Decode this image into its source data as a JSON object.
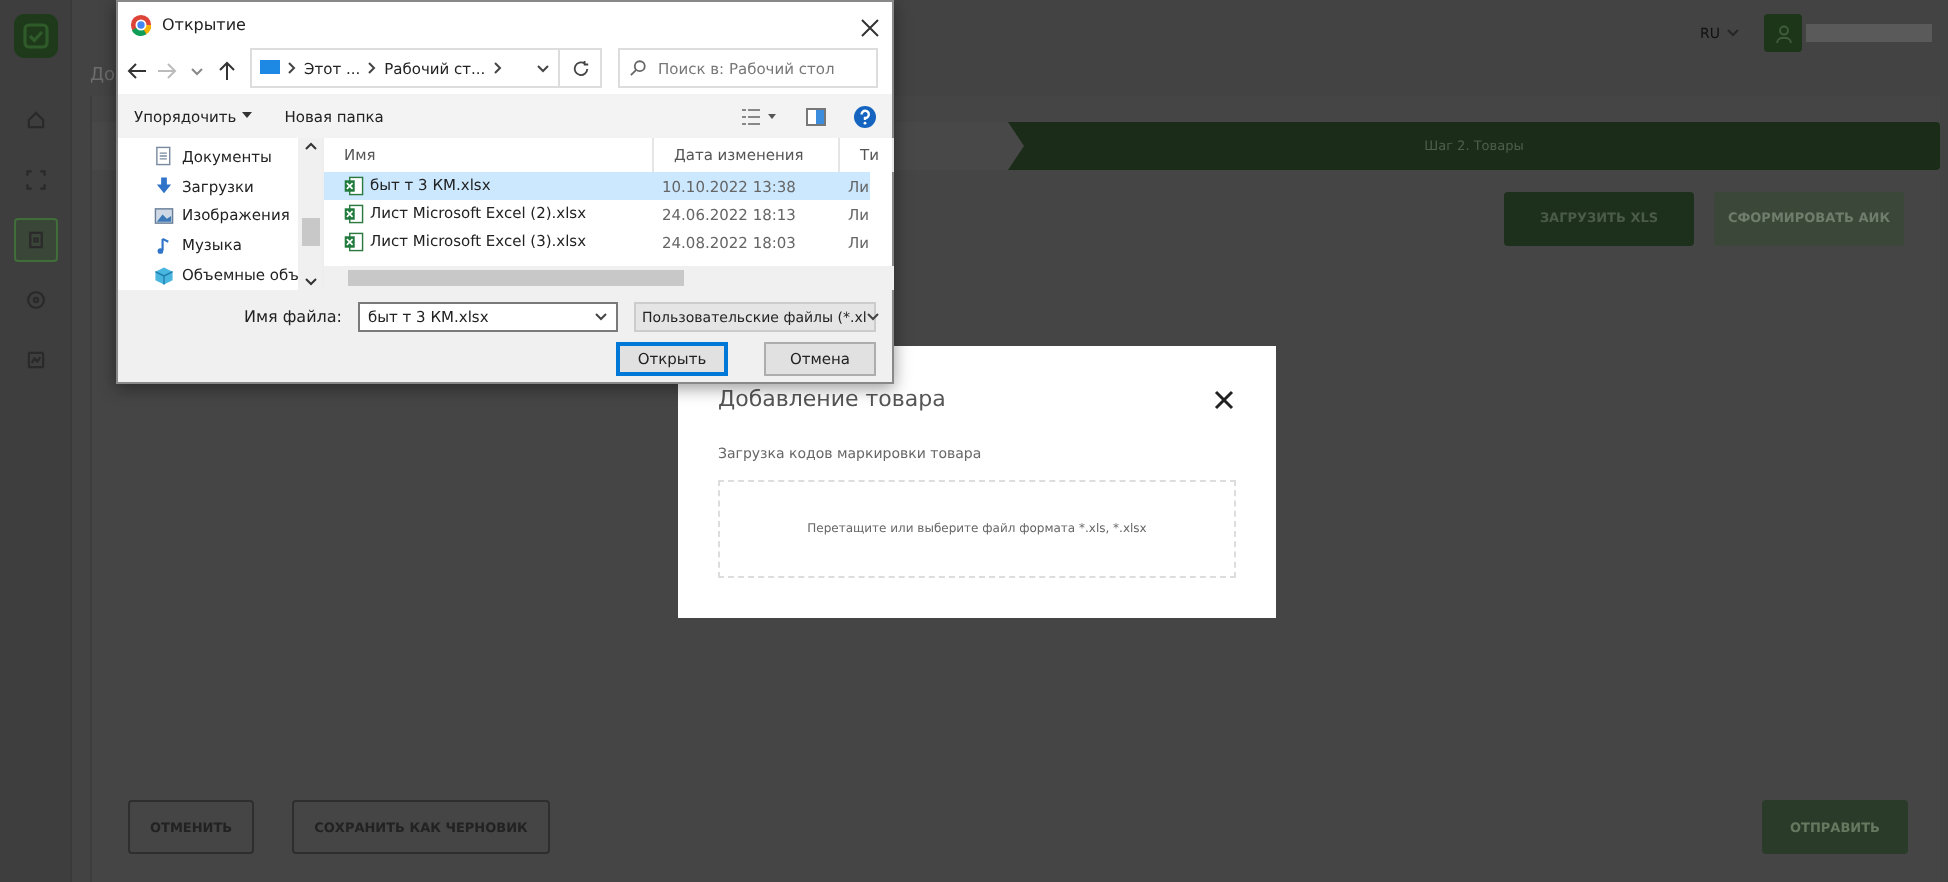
{
  "sidebar": {
    "items": [
      {
        "kind": "home",
        "selected": false
      },
      {
        "kind": "scan",
        "selected": false
      },
      {
        "kind": "document",
        "selected": true
      },
      {
        "kind": "wheel",
        "selected": false
      },
      {
        "kind": "report",
        "selected": false
      }
    ]
  },
  "header": {
    "language": "RU"
  },
  "breadcrumb": "До",
  "steps": [
    {
      "selected": false
    },
    {
      "label": "Шаг 2. Товары",
      "selected": true
    }
  ],
  "actions": [
    {
      "label": "ЗАГРУЗИТЬ XLS",
      "disabled": false
    },
    {
      "label": "СФОРМИРОВАТЬ АИК",
      "disabled": true
    }
  ],
  "footer": {
    "buttons": [
      {
        "label": "ОТМЕНИТЬ",
        "kind": "outline"
      },
      {
        "label": "СОХРАНИТЬ КАК ЧЕРНОВИК",
        "kind": "outline"
      },
      {
        "label": "ОТПРАВИТЬ",
        "kind": "primary"
      }
    ]
  },
  "modal": {
    "title": "Добавление товара",
    "label": "Загрузка кодов маркировки товара",
    "dropzone": "Перетащите или выберите файл формата *.xls, *.xlsx"
  },
  "file_dialog": {
    "title": "Открытие",
    "path": [
      "Этот ...",
      "Рабочий ст..."
    ],
    "search": {
      "placeholder": "Поиск в: Рабочий стол"
    },
    "toolbar": {
      "organize": "Упорядочить",
      "new_folder": "Новая папка"
    },
    "nav": [
      {
        "label": "Документы",
        "kind": "documents"
      },
      {
        "label": "Загрузки",
        "kind": "downloads"
      },
      {
        "label": "Изображения",
        "kind": "pictures"
      },
      {
        "label": "Музыка",
        "kind": "music"
      },
      {
        "label": "Объемные объ",
        "kind": "objects"
      }
    ],
    "columns": [
      "Имя",
      "Дата изменения",
      "Ти"
    ],
    "files": [
      {
        "name": "быт т 3 КМ.xlsx",
        "date": "10.10.2022 13:38",
        "column_3": "Ли",
        "selected": true
      },
      {
        "name": "Лист Microsoft Excel (2).xlsx",
        "date": "24.06.2022 18:13",
        "column_3": "Ли",
        "selected": false
      },
      {
        "name": "Лист Microsoft Excel (3).xlsx",
        "date": "24.08.2022 18:03",
        "column_3": "Ли",
        "selected": false
      }
    ],
    "filename_label": "Имя файла:",
    "filename": "быт т 3 КМ.xlsx",
    "filter": "Пользовательские файлы (*.xl",
    "open": "Открыть",
    "cancel": "Отмена"
  }
}
